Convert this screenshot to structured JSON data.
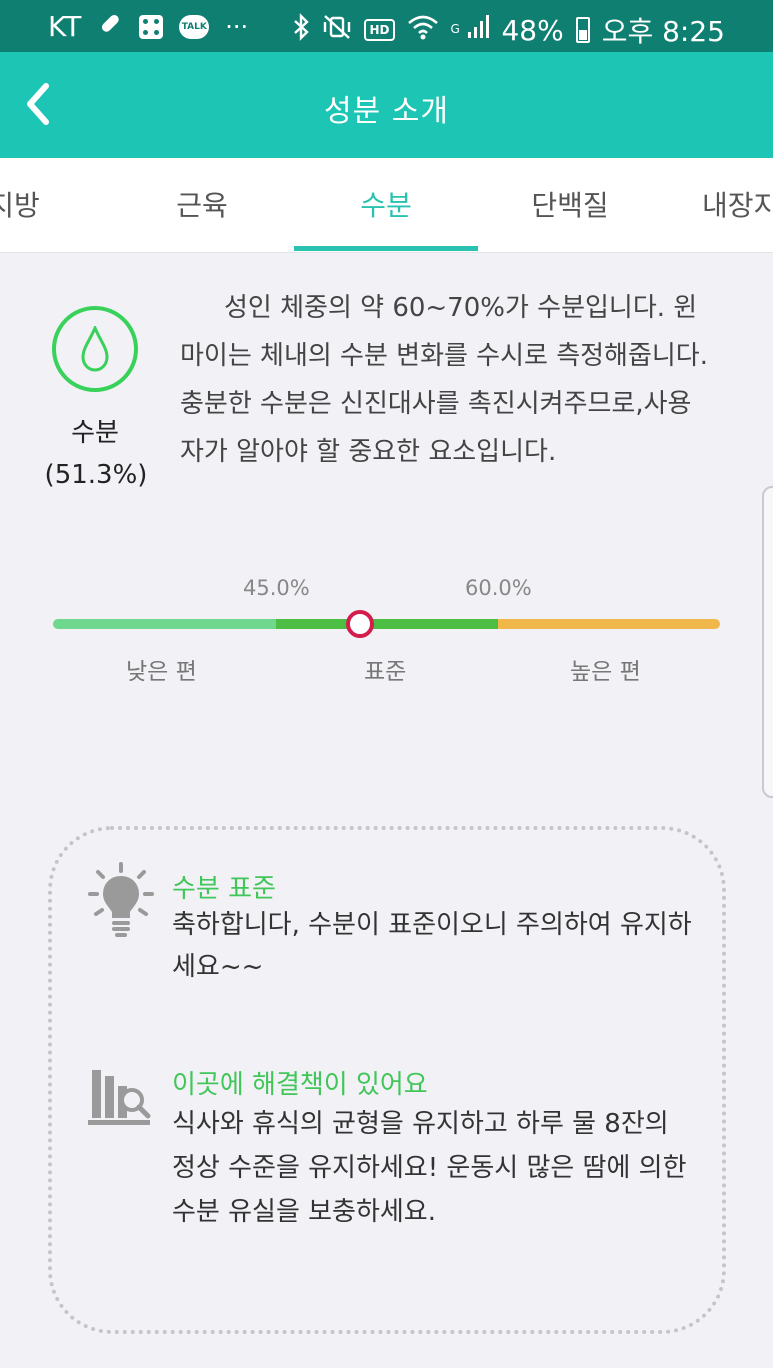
{
  "status_bar": {
    "carrier": "KT",
    "talk_label": "TALK",
    "more": "···",
    "hd": "HD",
    "network": "G",
    "battery": "48%",
    "time": "오후 8:25"
  },
  "header": {
    "title": "성분 소개"
  },
  "tabs": [
    {
      "label": "지방"
    },
    {
      "label": "근육"
    },
    {
      "label": "수분"
    },
    {
      "label": "단백질"
    },
    {
      "label": "내장지"
    }
  ],
  "active_tab": "수분",
  "intro": {
    "name": "수분",
    "percent": "(51.3%)",
    "description": "성인 체중의 약 60~70%가 수분입니다. 윈마이는 체내의 수분 변화를 수시로 측정해줍니다.충분한 수분은 신진대사를 촉진시켜주므로,사용자가 알아야 할 중요한 요소입니다."
  },
  "scale": {
    "threshold_low": "45.0%",
    "threshold_high": "60.0%",
    "label_low": "낮은 편",
    "label_standard": "표준",
    "label_high": "높은 편",
    "value_fraction": 0.463,
    "colors": {
      "low": "#6fd88f",
      "standard": "#4cbe43",
      "high": "#f0b84a",
      "marker": "#d31e4d"
    }
  },
  "advice": {
    "status_title": "수분 표준",
    "status_text": "축하합니다, 수분이 표준이오니 주의하여 유지하세요~~",
    "solution_title": "이곳에 해결책이 있어요",
    "solution_text": "식사와 휴식의 균형을 유지하고 하루 물 8잔의 정상 수준을 유지하세요! 운동시 많은 땀에 의한 수분 유실을 보충하세요."
  },
  "colors": {
    "status_bar": "#0f7f72",
    "app_bar": "#1dc5b4",
    "accent": "#29c2b0",
    "green": "#41c659"
  },
  "icons": {
    "back": "chevron-left-icon",
    "water": "water-drop-icon",
    "tip": "lightbulb-icon",
    "solution": "chart-search-icon"
  }
}
